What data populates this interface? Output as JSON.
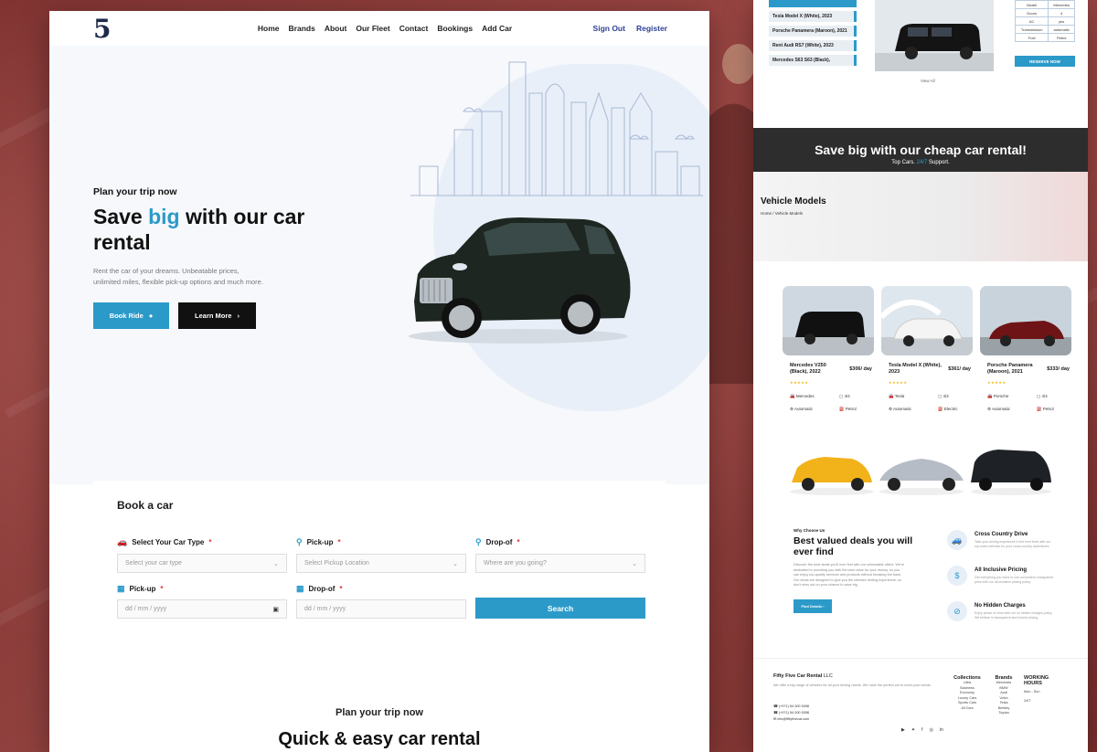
{
  "left": {
    "logo": "5",
    "nav": {
      "links": [
        "Home",
        "Brands",
        "About",
        "Our Fleet",
        "Contact",
        "Bookings",
        "Add Car"
      ],
      "sign_out": "Sign Out",
      "register": "Register"
    },
    "hero": {
      "kicker": "Plan your trip now",
      "title_pre": "Save ",
      "title_accent": "big",
      "title_post": " with our car rental",
      "description": "Rent the car of your dreams. Unbeatable prices, unlimited miles, flexible pick-up options and much more.",
      "book_ride": "Book Ride",
      "learn_more": "Learn More"
    },
    "booking": {
      "title": "Book a car",
      "car_type_label": "Select Your Car Type",
      "car_type_placeholder": "Select your car type",
      "pickup_label": "Pick-up",
      "pickup_placeholder": "Select Pickup Location",
      "dropoff_label": "Drop-of",
      "dropoff_placeholder": "Where are you going?",
      "pickup_date_label": "Pick-up",
      "pickup_date_value": "dd / mm / yyyy",
      "dropoff_date_label": "Drop-of",
      "dropoff_date_value": "dd / mm / yyyy",
      "required_mark": "*",
      "search": "Search"
    },
    "bottom": {
      "kicker": "Plan your trip now",
      "title": "Quick & easy car rental"
    }
  },
  "right": {
    "top_list": [
      "Tesla Model X (White), 2023",
      "Porsche Panamera (Maroon), 2021",
      "Rent Audi RS7 (White), 2023",
      "Mercedes S63 S63 (Black),"
    ],
    "spec_table": [
      [
        "Model",
        "Mercedes"
      ],
      [
        "Doors",
        "4"
      ],
      [
        "AC",
        "yes"
      ],
      [
        "Transmission",
        "automatic"
      ],
      [
        "Fuel",
        "Petrol"
      ]
    ],
    "reserve_now": "RESERVE NOW",
    "view_all": "View All",
    "banner": {
      "title": "Save big with our cheap car rental!",
      "sub_pre": "Top Cars. ",
      "sub_highlight": "24/7",
      "sub_post": " Support."
    },
    "models": {
      "title": "Vehicle Models",
      "breadcrumb": "Home / Vehicle Models"
    },
    "cards": [
      {
        "name": "Mercedes V250 (Black), 2022",
        "price": "$306/ day",
        "stars": "★★★★★",
        "brand": "Mercedes",
        "seats": "4/4",
        "transmission": "Automatic",
        "fuel": "Petrol"
      },
      {
        "name": "Tesla Model X (White), 2023",
        "price": "$361/ day",
        "stars": "★★★★★",
        "brand": "Tesla",
        "seats": "4/4",
        "transmission": "Automatic",
        "fuel": "Electric"
      },
      {
        "name": "Porsche Panamera (Maroon), 2021",
        "price": "$333/ day",
        "stars": "★★★★★",
        "brand": "Porsche",
        "seats": "4/4",
        "transmission": "Automatic",
        "fuel": "Petrol"
      }
    ],
    "why": {
      "kicker": "Why Choose Us",
      "title": "Best valued deals you will ever find",
      "text": "Discover the best deals you'll ever find with our unbeatable offers. We're dedicated to providing you with the best value for your money, so you can enjoy top-quality services and products without breaking the bank. Our deals are designed to give you the ultimate renting experience, so don't miss out on your chance to save big.",
      "button": "Find Details"
    },
    "features": [
      {
        "title": "Cross Country Drive",
        "text": "Take your driving experience to the next level with our top-notch vehicles for your cross-country adventures."
      },
      {
        "title": "All Inclusive Pricing",
        "text": "Get everything you need in one convenient, transparent price with our all-inclusive pricing policy."
      },
      {
        "title": "No Hidden Charges",
        "text": "Enjoy peace of mind with our no hidden charges policy. We believe in transparent and honest pricing."
      }
    ],
    "footer": {
      "company_name": "Fifty Five Car Rental",
      "company_suffix": "LLC",
      "description": "We offer a big range of vehicles for all your driving needs. We have the perfect car to meet your needs.",
      "phone1": "(+971) 54 000 5398",
      "phone2": "(+971) 54 000 5398",
      "email": "info@fiftyfivecar.com",
      "collections_title": "Collections",
      "collections": [
        "Ultra",
        "Business",
        "Economy",
        "Luxury Cars",
        "Sports Cars",
        "All Cars"
      ],
      "brands_title": "Brands",
      "brands": [
        "Mercedes",
        "BMW",
        "Audi",
        "Volvo",
        "Tesla",
        "Bentley",
        "Toyota"
      ],
      "hours_title": "WORKING HOURS",
      "hours_days": "Mon - Sun",
      "hours_time": "24/7",
      "social": [
        "▶",
        "✦",
        "f",
        "◎",
        "in"
      ]
    }
  },
  "colors": {
    "accent": "#2b9ac9",
    "nav_auth": "#2f3f98",
    "dark": "#111111",
    "banner": "#2d2d2d",
    "backdrop": "#8a3a38"
  }
}
